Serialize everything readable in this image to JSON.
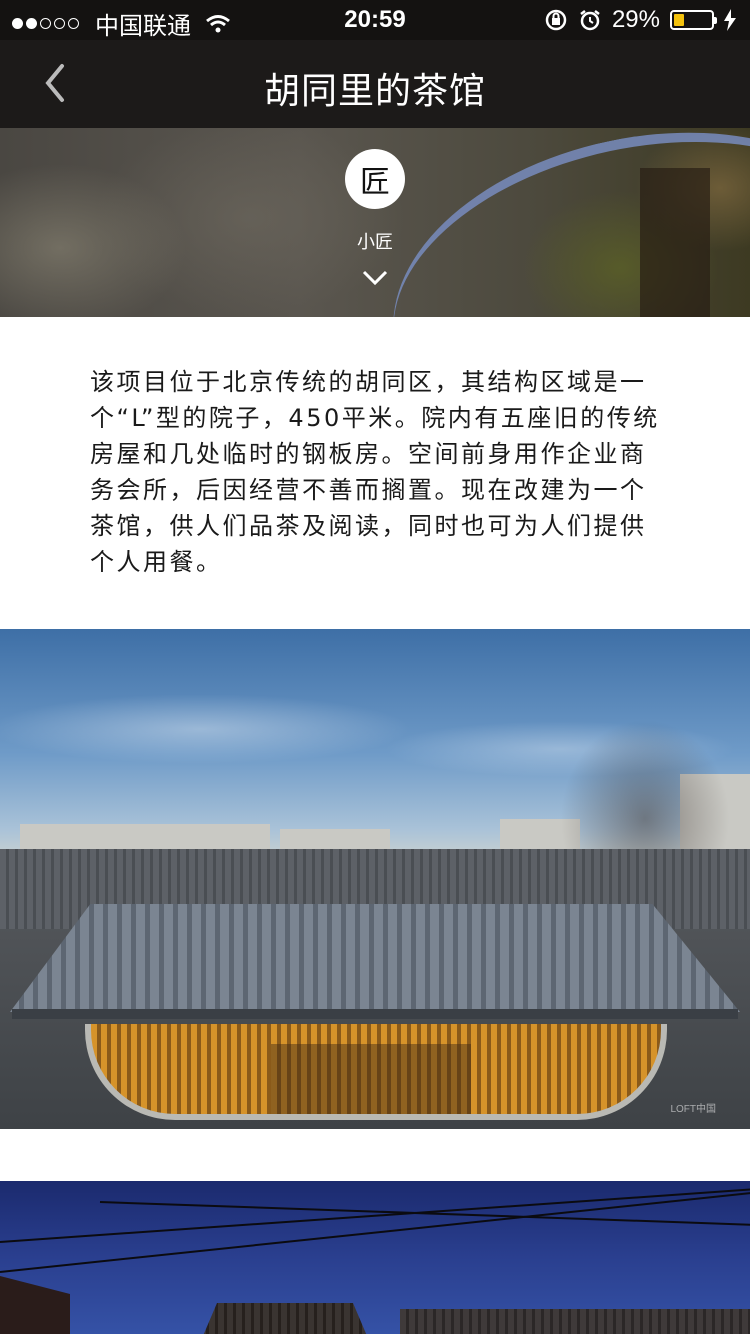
{
  "status_bar": {
    "carrier": "中国联通",
    "time": "20:59",
    "battery_percent": "29%",
    "battery_level": 0.29,
    "signal_bars_on": 2,
    "signal_bars_total": 5
  },
  "nav": {
    "title": "胡同里的茶馆",
    "back_icon": "chevron-left-icon"
  },
  "author": {
    "avatar_glyph": "匠",
    "name": "小匠"
  },
  "article": {
    "description": "该项目位于北京传统的胡同区，其结构区域是一个“L”型的院子，450平米。院内有五座旧的传统房屋和几处临时的钢板房。空间前身用作企业商务会所，后因经营不善而搁置。现在改建为一个茶馆，供人们品茶及阅读，同时也可为人们提供个人用餐。"
  },
  "photos": [
    {
      "watermark": "LOFT中国"
    },
    {}
  ],
  "colors": {
    "status_bg": "#141211",
    "nav_bg": "#1c1a19",
    "battery": "#f4c20d"
  }
}
